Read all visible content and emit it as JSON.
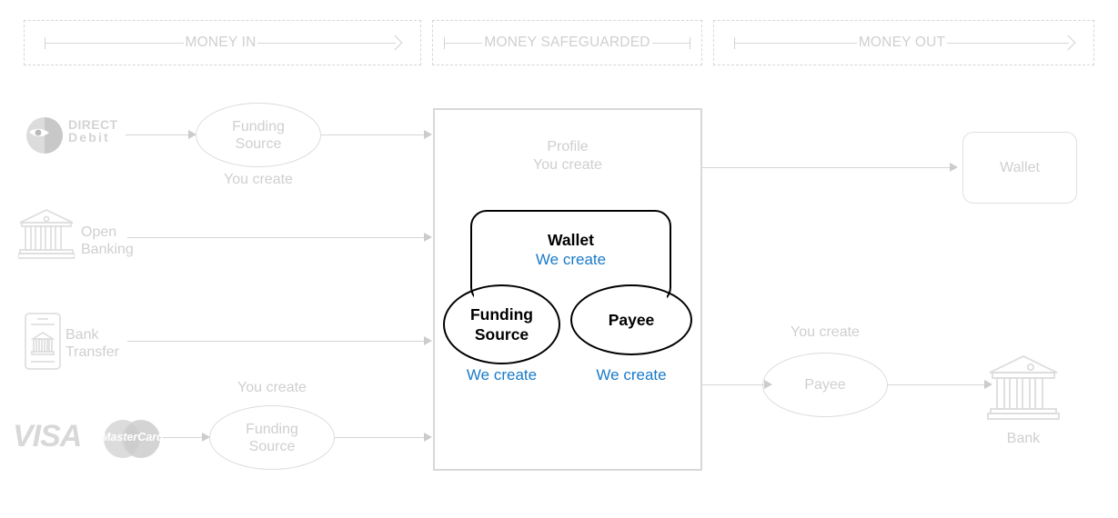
{
  "phases": [
    {
      "label": "MONEY IN",
      "name": "money-in",
      "start_cap": true,
      "end_arrow": true
    },
    {
      "label": "MONEY SAFEGUARDED",
      "name": "money-safeguarded",
      "start_cap": true,
      "end_arrow": false
    },
    {
      "label": "MONEY OUT",
      "name": "money-out",
      "start_cap": true,
      "end_arrow": true
    }
  ],
  "money_in": {
    "direct_debit": {
      "line1": "DIRECT",
      "line2": "Debit",
      "icon": "direct-debit-logo"
    },
    "open_banking": {
      "label": "Open\nBanking",
      "icon": "bank-building-icon"
    },
    "bank_transfer": {
      "label": "Bank\nTransfer",
      "icon": "mobile-bank-icon"
    },
    "cards": {
      "visa": "VISA",
      "mastercard": "MasterCard"
    },
    "funding_source_top": {
      "label": "Funding\nSource",
      "caption": "You create"
    },
    "funding_source_bottom": {
      "label": "Funding\nSource",
      "caption": "You create"
    }
  },
  "profile": {
    "title": "Profile",
    "caption": "You create",
    "wallet": {
      "label": "Wallet",
      "creator": "We create"
    },
    "funding_source": {
      "label": "Funding\nSource",
      "creator": "We create"
    },
    "payee": {
      "label": "Payee",
      "creator": "We create"
    }
  },
  "money_out": {
    "wallet": {
      "label": "Wallet"
    },
    "payee": {
      "label": "Payee",
      "caption": "You create"
    },
    "bank": {
      "label": "Bank",
      "icon": "bank-building-icon"
    }
  },
  "colors": {
    "accent_blue": "#1a7ac8",
    "line_grey": "#d5d5d5",
    "text_grey": "#cfcfcf",
    "black": "#000000"
  }
}
